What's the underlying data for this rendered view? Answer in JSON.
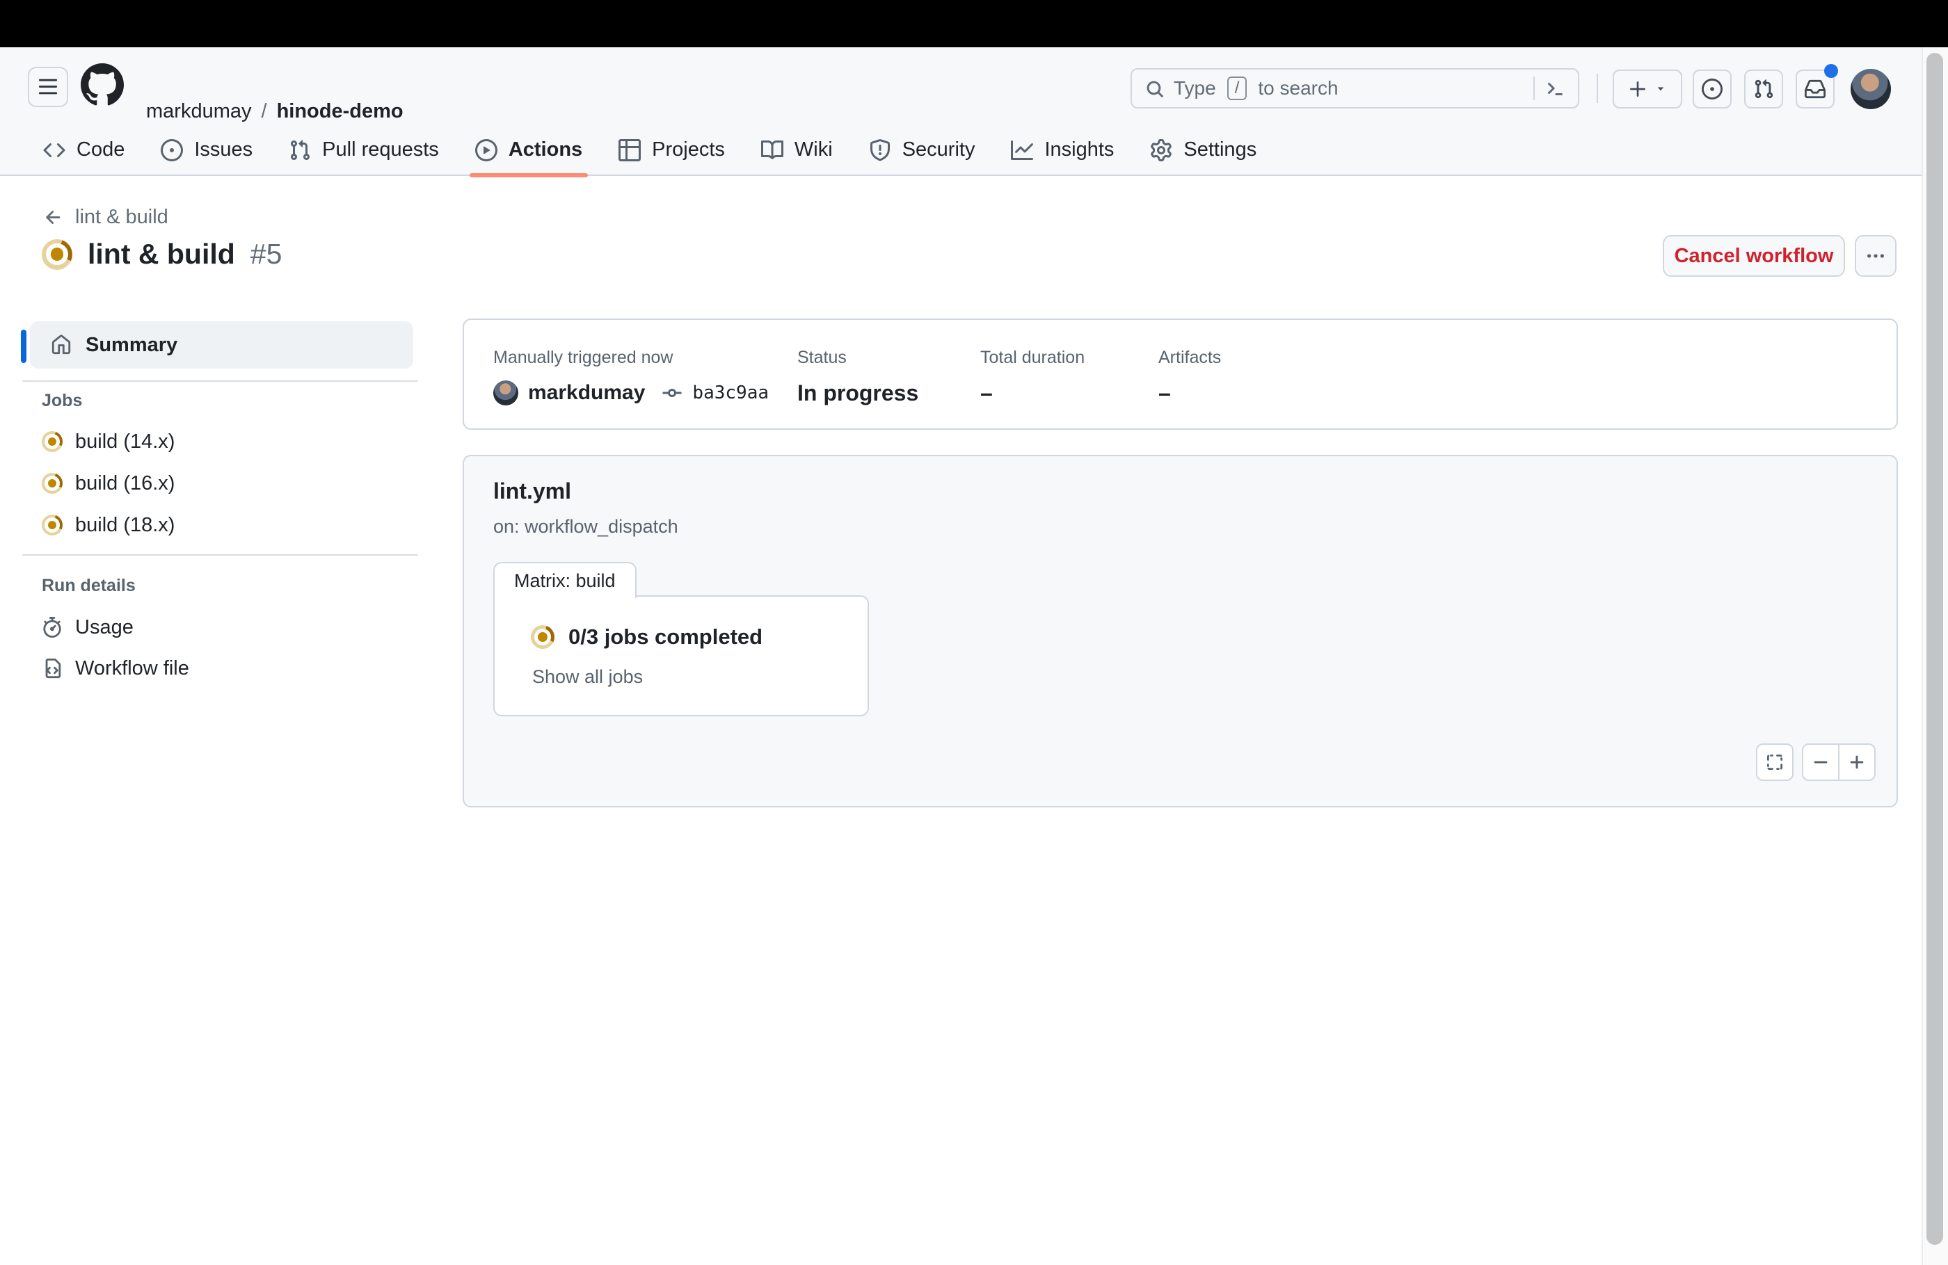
{
  "header": {
    "breadcrumb": {
      "owner": "markdumay",
      "separator": "/",
      "repo": "hinode-demo"
    },
    "search": {
      "placeholder_prefix": "Type",
      "slash_key": "/",
      "placeholder_suffix": "to search"
    }
  },
  "nav": {
    "tabs": [
      {
        "label": "Code",
        "active": false
      },
      {
        "label": "Issues",
        "active": false
      },
      {
        "label": "Pull requests",
        "active": false
      },
      {
        "label": "Actions",
        "active": true
      },
      {
        "label": "Projects",
        "active": false
      },
      {
        "label": "Wiki",
        "active": false
      },
      {
        "label": "Security",
        "active": false
      },
      {
        "label": "Insights",
        "active": false
      },
      {
        "label": "Settings",
        "active": false
      }
    ]
  },
  "run": {
    "back_label": "lint & build",
    "title": "lint & build",
    "number": "#5",
    "cancel_label": "Cancel workflow"
  },
  "sidebar": {
    "summary_label": "Summary",
    "jobs_heading": "Jobs",
    "jobs": [
      "build (14.x)",
      "build (16.x)",
      "build (18.x)"
    ],
    "run_details_heading": "Run details",
    "usage_label": "Usage",
    "workflow_file_label": "Workflow file"
  },
  "summary_card": {
    "trigger_label": "Manually triggered now",
    "actor": "markdumay",
    "commit": "ba3c9aa",
    "status_label": "Status",
    "status_value": "In progress",
    "duration_label": "Total duration",
    "duration_value": "–",
    "artifacts_label": "Artifacts",
    "artifacts_value": "–"
  },
  "workflow_graph": {
    "file": "lint.yml",
    "trigger": "on: workflow_dispatch",
    "matrix_tab": "Matrix: build",
    "progress": "0/3 jobs completed",
    "show_all": "Show all jobs"
  },
  "colors": {
    "accent": "#0969da",
    "danger": "#cf222e",
    "attention": "#bf8700",
    "tab_underline": "#fd8c73",
    "border": "#d0d7de",
    "muted": "#59636e",
    "canvas_subtle": "#f6f8fa",
    "notification": "#1f6feb"
  }
}
